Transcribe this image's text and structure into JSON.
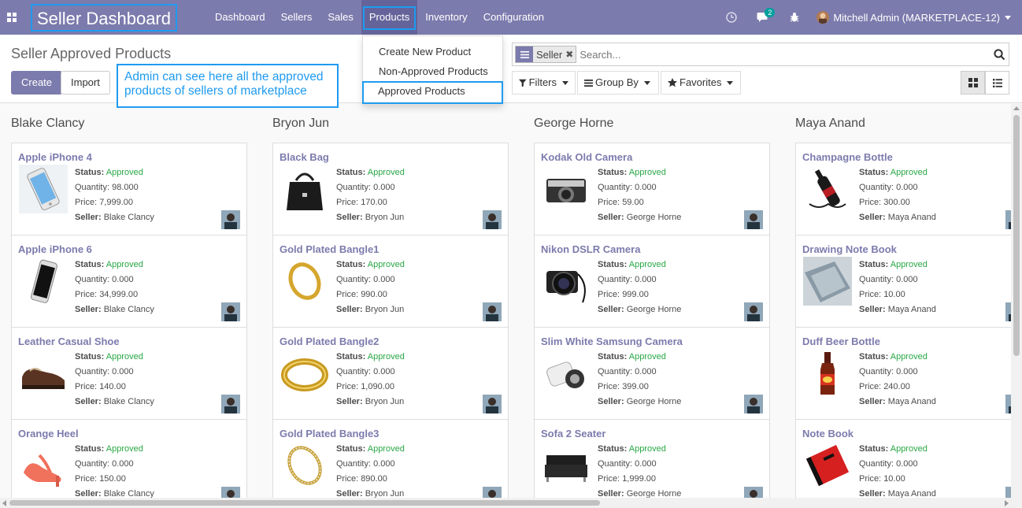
{
  "navbar": {
    "brand": "Seller Dashboard",
    "menu": [
      "Dashboard",
      "Sellers",
      "Sales",
      "Products",
      "Inventory",
      "Configuration"
    ],
    "active_menu": "Products",
    "messages_count": "2",
    "user": "Mitchell Admin (MARKETPLACE-12)",
    "colors": {
      "navbar": "#7c7bad",
      "highlight": "#1e9bf0"
    }
  },
  "products_menu": {
    "items": [
      "Create New Product",
      "Non-Approved Products",
      "Approved Products"
    ],
    "highlighted": "Approved Products"
  },
  "control": {
    "title": "Seller Approved Products",
    "create_label": "Create",
    "import_label": "Import",
    "note": "Admin can see here all the approved\n products of sellers of marketplace",
    "search_facet": "Seller",
    "search_placeholder": "Search...",
    "filters_label": "Filters",
    "groupby_label": "Group By",
    "favorites_label": "Favorites"
  },
  "labels": {
    "status": "Status:",
    "quantity": "Quantity:",
    "price": "Price:",
    "seller": "Seller:"
  },
  "columns": [
    {
      "title": "Blake Clancy",
      "cards": [
        {
          "name": "Apple iPhone 4",
          "status": "Approved",
          "quantity": "98.000",
          "price": "7,999.00",
          "seller": "Blake Clancy",
          "img": "phone-white"
        },
        {
          "name": "Apple iPhone 6",
          "status": "Approved",
          "quantity": "0.000",
          "price": "34,999.00",
          "seller": "Blake Clancy",
          "img": "phone-black"
        },
        {
          "name": "Leather Casual Shoe",
          "status": "Approved",
          "quantity": "0.000",
          "price": "140.00",
          "seller": "Blake Clancy",
          "img": "shoe"
        },
        {
          "name": "Orange Heel",
          "status": "Approved",
          "quantity": "0.000",
          "price": "150.00",
          "seller": "Blake Clancy",
          "img": "heel"
        }
      ]
    },
    {
      "title": "Bryon Jun",
      "cards": [
        {
          "name": "Black Bag",
          "status": "Approved",
          "quantity": "0.000",
          "price": "170.00",
          "seller": "Bryon Jun",
          "img": "bag"
        },
        {
          "name": "Gold Plated Bangle1",
          "status": "Approved",
          "quantity": "0.000",
          "price": "990.00",
          "seller": "Bryon Jun",
          "img": "bangle"
        },
        {
          "name": "Gold Plated Bangle2",
          "status": "Approved",
          "quantity": "0.000",
          "price": "1,090.00",
          "seller": "Bryon Jun",
          "img": "bangle-wide"
        },
        {
          "name": "Gold Plated Bangle3",
          "status": "Approved",
          "quantity": "0.000",
          "price": "890.00",
          "seller": "Bryon Jun",
          "img": "bangle-thin"
        }
      ]
    },
    {
      "title": "George Horne",
      "cards": [
        {
          "name": "Kodak Old Camera",
          "status": "Approved",
          "quantity": "0.000",
          "price": "59.00",
          "seller": "George Horne",
          "img": "camera-old"
        },
        {
          "name": "Nikon DSLR Camera",
          "status": "Approved",
          "quantity": "0.000",
          "price": "999.00",
          "seller": "George Horne",
          "img": "camera-dslr"
        },
        {
          "name": "Slim White Samsung Camera",
          "status": "Approved",
          "quantity": "0.000",
          "price": "399.00",
          "seller": "George Horne",
          "img": "camera-white"
        },
        {
          "name": "Sofa 2 Seater",
          "status": "Approved",
          "quantity": "0.000",
          "price": "1,999.00",
          "seller": "George Horne",
          "img": "sofa"
        }
      ]
    },
    {
      "title": "Maya Anand",
      "cards": [
        {
          "name": "Champagne Bottle",
          "status": "Approved",
          "quantity": "0.000",
          "price": "300.00",
          "seller": "Maya Anand",
          "img": "champagne"
        },
        {
          "name": "Drawing Note Book",
          "status": "Approved",
          "quantity": "0.000",
          "price": "10.00",
          "seller": "Maya Anand",
          "img": "notebook"
        },
        {
          "name": "Duff Beer Bottle",
          "status": "Approved",
          "quantity": "0.000",
          "price": "240.00",
          "seller": "Maya Anand",
          "img": "beer"
        },
        {
          "name": "Note Book",
          "status": "Approved",
          "quantity": "0.000",
          "price": "10.00",
          "seller": "Maya Anand",
          "img": "notebook-red"
        }
      ]
    }
  ]
}
